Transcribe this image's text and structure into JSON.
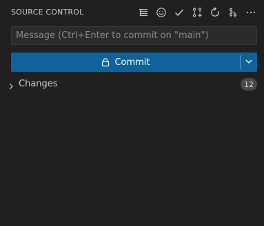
{
  "panel": {
    "title": "SOURCE CONTROL"
  },
  "toolbar": {
    "actions": [
      {
        "name": "view-as-tree-icon",
        "tooltip": "View as Tree"
      },
      {
        "name": "emoji-icon",
        "tooltip": "Emoji"
      },
      {
        "name": "check-icon",
        "tooltip": "Commit"
      },
      {
        "name": "pull-request-icon",
        "tooltip": "Create Pull Request"
      },
      {
        "name": "refresh-icon",
        "tooltip": "Refresh"
      },
      {
        "name": "graph-icon",
        "tooltip": "Source Control Graph"
      },
      {
        "name": "more-actions-icon",
        "tooltip": "More Actions"
      }
    ]
  },
  "commit_message": {
    "value": "",
    "placeholder": "Message (Ctrl+Enter to commit on \"main\")"
  },
  "commit_button": {
    "label": "Commit",
    "icon": "lock-icon",
    "dropdown_icon": "chevron-down-icon"
  },
  "changes": {
    "label": "Changes",
    "count": "12",
    "expanded": false
  },
  "colors": {
    "background": "#202020",
    "accent": "#0e639c",
    "text": "#cccccc",
    "badge": "#4a4a4a"
  }
}
